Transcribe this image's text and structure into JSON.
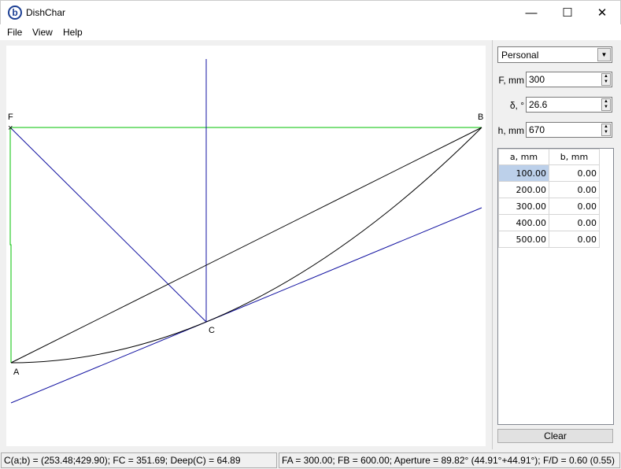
{
  "window": {
    "title": "DishChar",
    "icon_letter": "b",
    "minimize": "—",
    "maximize": "☐",
    "close": "✕"
  },
  "menu": [
    "File",
    "View",
    "Help"
  ],
  "drawing": {
    "labels": {
      "F": "F",
      "B": "B",
      "A": "A",
      "C": "C"
    }
  },
  "panel": {
    "mode": "Personal",
    "fields": [
      {
        "label": "F, mm",
        "value": "300"
      },
      {
        "label": "δ, °",
        "value": "26.6"
      },
      {
        "label": "h, mm",
        "value": "670"
      }
    ],
    "table": {
      "headers": [
        "a, mm",
        "b, mm"
      ],
      "rows": [
        [
          "100.00",
          "0.00"
        ],
        [
          "200.00",
          "0.00"
        ],
        [
          "300.00",
          "0.00"
        ],
        [
          "400.00",
          "0.00"
        ],
        [
          "500.00",
          "0.00"
        ]
      ]
    },
    "clear_label": "Clear"
  },
  "status": {
    "left": "C(a;b) = (253.48;429.90); FC = 351.69; Deep(C) = 64.89",
    "right": "FA = 300.00; FB = 600.00; Aperture = 89.82° (44.91°+44.91°); F/D = 0.60 (0.55)"
  }
}
